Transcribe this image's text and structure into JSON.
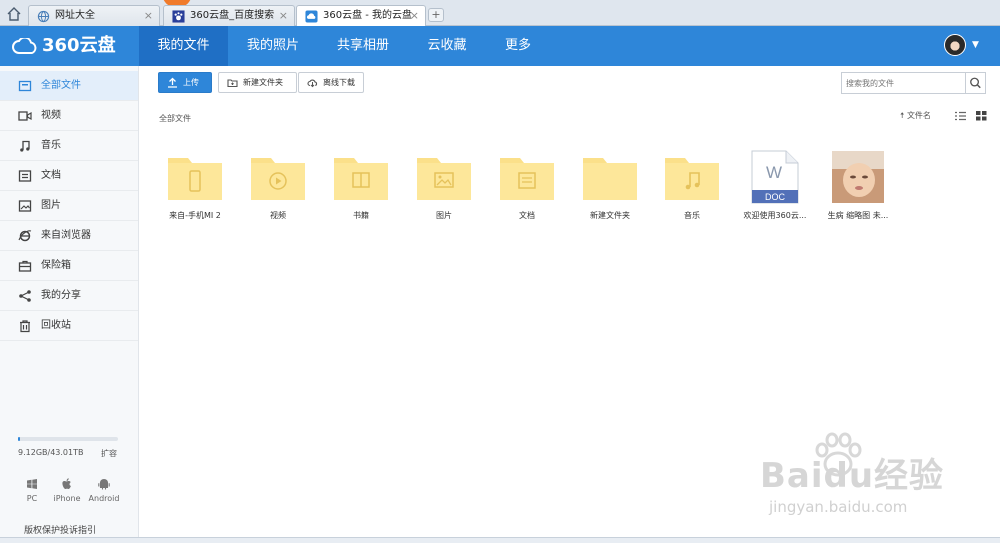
{
  "browser": {
    "tabs": [
      {
        "label": "网址大全",
        "icon": "globe-icon",
        "active": false
      },
      {
        "label": "360云盘_百度搜索",
        "icon": "baidu-paw-icon",
        "active": false
      },
      {
        "label": "360云盘 - 我的云盘",
        "icon": "cloud-icon",
        "active": true
      }
    ],
    "new_tab": "+"
  },
  "header": {
    "logo": "360云盘",
    "nav": [
      "我的文件",
      "我的照片",
      "共享相册",
      "云收藏",
      "更多"
    ],
    "active_nav": "我的文件"
  },
  "sidebar": {
    "items": [
      {
        "label": "全部文件",
        "icon": "all-files-icon"
      },
      {
        "label": "视频",
        "icon": "video-icon"
      },
      {
        "label": "音乐",
        "icon": "music-icon"
      },
      {
        "label": "文档",
        "icon": "document-icon"
      },
      {
        "label": "图片",
        "icon": "image-icon"
      },
      {
        "label": "来自浏览器",
        "icon": "ie-browser-icon"
      },
      {
        "label": "保险箱",
        "icon": "safe-box-icon"
      },
      {
        "label": "我的分享",
        "icon": "share-icon"
      },
      {
        "label": "回收站",
        "icon": "trash-icon"
      }
    ],
    "quota": {
      "text": "9.12GB/43.01TB",
      "expand": "扩容",
      "used_fraction": 0.0002
    },
    "platforms": [
      {
        "label": "PC",
        "icon": "windows-icon"
      },
      {
        "label": "iPhone",
        "icon": "apple-icon"
      },
      {
        "label": "Android",
        "icon": "android-icon"
      }
    ],
    "copyright": "版权保护投诉指引"
  },
  "toolbar": {
    "upload": "上传",
    "new_folder": "新建文件夹",
    "offline_download": "离线下载",
    "search_placeholder": "搜索我的文件",
    "sort_label": "文件名"
  },
  "breadcrumb": "全部文件",
  "files": [
    {
      "name": "来自-手机MI 2",
      "type": "folder",
      "glyph": "phone-icon"
    },
    {
      "name": "视频",
      "type": "folder",
      "glyph": "play-icon"
    },
    {
      "name": "书籍",
      "type": "folder",
      "glyph": "book-icon"
    },
    {
      "name": "图片",
      "type": "folder",
      "glyph": "picture-icon"
    },
    {
      "name": "文档",
      "type": "folder",
      "glyph": "doc-lines-icon"
    },
    {
      "name": "新建文件夹",
      "type": "folder",
      "glyph": ""
    },
    {
      "name": "音乐",
      "type": "folder",
      "glyph": "music-note-icon"
    },
    {
      "name": "欢迎使用360云...",
      "type": "doc",
      "badge": "DOC",
      "letter": "W"
    },
    {
      "name": "生病 缩略图 未...",
      "type": "photo"
    }
  ],
  "watermark": {
    "brand": "Baidu经验",
    "url": "jingyan.baidu.com"
  },
  "colors": {
    "brand_blue": "#2e86d9",
    "folder_yellow": "#fbe08a"
  }
}
